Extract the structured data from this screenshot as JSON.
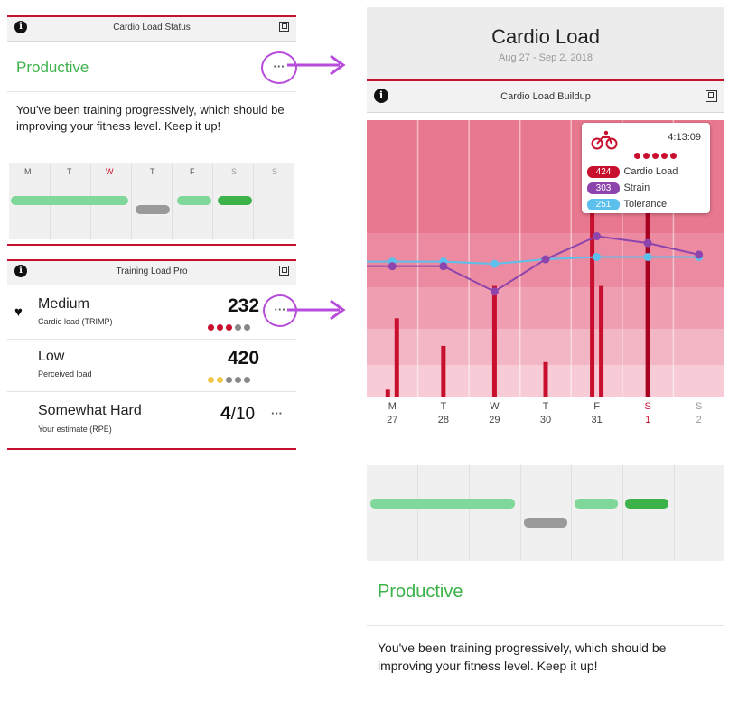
{
  "status_card": {
    "title": "Cardio Load Status",
    "status": "Productive",
    "description": "You've been training progressively, which should be improving your fitness level. Keep it up!",
    "days": [
      "M",
      "T",
      "W",
      "T",
      "F",
      "S",
      "S"
    ],
    "more_label": "···"
  },
  "training_card": {
    "title": "Training Load Pro",
    "rows": [
      {
        "label": "Medium",
        "sublabel": "Cardio load (TRIMP)",
        "value": "232",
        "dots": [
          "#c8102e",
          "#c8102e",
          "#c8102e",
          "#888888",
          "#888888"
        ]
      },
      {
        "label": "Low",
        "sublabel": "Perceived load",
        "value": "420",
        "dots": [
          "#f2c94c",
          "#f2c94c",
          "#888888",
          "#888888",
          "#888888"
        ]
      },
      {
        "label": "Somewhat Hard",
        "sublabel": "Your estimate (RPE)",
        "value_main": "4",
        "value_suffix": "/10",
        "more": "···"
      }
    ],
    "more_label": "···"
  },
  "detail": {
    "title": "Cardio Load",
    "date_range": "Aug 27 - Sep 2, 2018",
    "chart_header": "Cardio Load Buildup",
    "tooltip": {
      "time": "4:13:09",
      "items": [
        {
          "value": "424",
          "label": "Cardio Load",
          "color": "#c8102e"
        },
        {
          "value": "303",
          "label": "Strain",
          "color": "#8e44ad"
        },
        {
          "value": "251",
          "label": "Tolerance",
          "color": "#5bc0eb"
        }
      ]
    },
    "status": "Productive",
    "description": "You've been training progressively, which should be improving your fitness level. Keep it up!"
  },
  "chart_data": {
    "type": "bar",
    "title": "",
    "categories": [
      {
        "day": "M",
        "date": "27"
      },
      {
        "day": "T",
        "date": "28"
      },
      {
        "day": "W",
        "date": "29"
      },
      {
        "day": "T",
        "date": "30"
      },
      {
        "day": "F",
        "date": "31"
      },
      {
        "day": "S",
        "date": "1"
      },
      {
        "day": "S",
        "date": "2"
      }
    ],
    "series": [
      {
        "name": "Cardio Load",
        "type": "bar",
        "color": "#c8102e"
      },
      {
        "name": "Strain",
        "type": "line",
        "color": "#8e44ad"
      },
      {
        "name": "Tolerance",
        "type": "line",
        "color": "#5bc0eb"
      }
    ],
    "bars": [
      {
        "day_index": 0,
        "values": [
          15,
          170
        ]
      },
      {
        "day_index": 1,
        "values": [
          110
        ]
      },
      {
        "day_index": 2,
        "values": [
          240
        ]
      },
      {
        "day_index": 3,
        "values": [
          75
        ]
      },
      {
        "day_index": 4,
        "values": [
          480,
          240
        ]
      },
      {
        "day_index": 5,
        "values": [
          424
        ]
      },
      {
        "day_index": 6,
        "values": []
      }
    ],
    "strain": [
      283,
      283,
      283,
      228,
      298,
      348,
      333,
      308
    ],
    "tolerance": [
      293,
      293,
      293,
      288,
      298,
      303,
      303,
      303
    ],
    "ylim": [
      0,
      600
    ],
    "highlight_day_index": 5,
    "muted_day_index": 6,
    "highlight_color": "#c8102e"
  },
  "colors": {
    "accent_red": "#c8102e",
    "green": "#3db24b",
    "light_green": "#7fd89a",
    "gray_pill": "#9a9a9a",
    "arrow_purple": "#b64bdc"
  }
}
